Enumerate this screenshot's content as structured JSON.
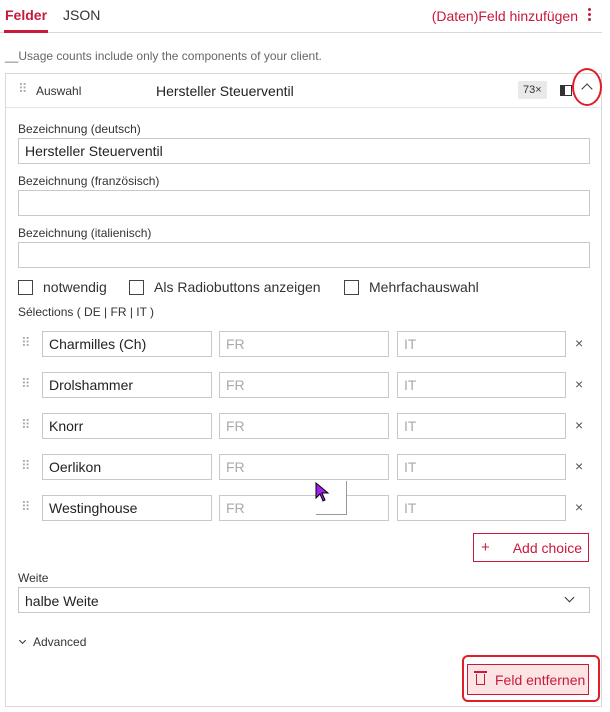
{
  "tabs": {
    "fields": "Felder",
    "json": "JSON"
  },
  "header": {
    "add_field": "(Daten)Feld hinzufügen"
  },
  "usage_note": "__Usage counts include only the components of your client.",
  "field": {
    "type": "Auswahl",
    "title": "Hersteller Steuerventil",
    "count": "73×",
    "label_de": "Bezeichnung (deutsch)",
    "value_de": "Hersteller Steuerventil",
    "label_fr": "Bezeichnung (französisch)",
    "value_fr": "",
    "label_it": "Bezeichnung (italienisch)",
    "value_it": "",
    "checkboxes": [
      {
        "label": "notwendig",
        "checked": false
      },
      {
        "label": "Als Radiobuttons anzeigen",
        "checked": false
      },
      {
        "label": "Mehrfachauswahl",
        "checked": false
      }
    ],
    "selections_label": "Sélections ( DE | FR | IT )",
    "selections": [
      {
        "de": "Charmilles (Ch)",
        "fr_placeholder": "FR",
        "it_placeholder": "IT"
      },
      {
        "de": "Drolshammer",
        "fr_placeholder": "FR",
        "it_placeholder": "IT"
      },
      {
        "de": "Knorr",
        "fr_placeholder": "FR",
        "it_placeholder": "IT"
      },
      {
        "de": "Oerlikon",
        "fr_placeholder": "FR",
        "it_placeholder": "IT"
      },
      {
        "de": "Westinghouse",
        "fr_placeholder": "FR",
        "it_placeholder": "IT"
      }
    ],
    "remove_glyph": "×",
    "add_choice": "Add choice",
    "add_choice_glyph": "+",
    "width_label": "Weite",
    "width_value": "halbe Weite",
    "advanced": "Advanced",
    "remove_field": "Feld entfernen"
  },
  "colors": {
    "accent": "#c8193c",
    "highlight": "#e11d2a",
    "cursor": "#a020f0"
  }
}
